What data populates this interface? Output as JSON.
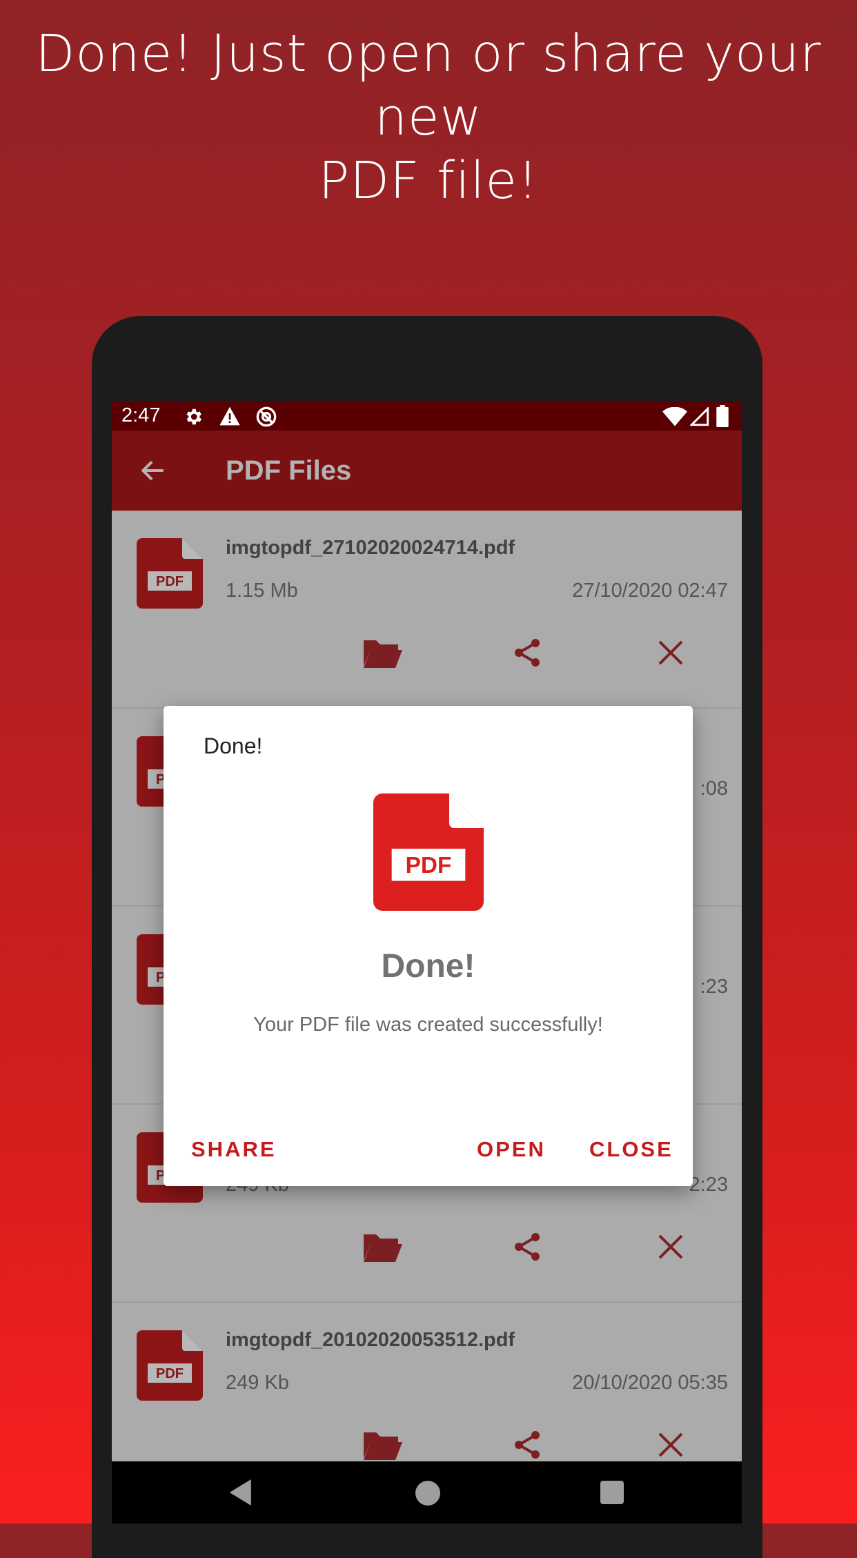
{
  "headline": {
    "line1": "Done! Just open or share your new",
    "line2": "PDF file!"
  },
  "status_bar": {
    "time": "2:47",
    "left_icons": [
      "gear-icon",
      "warning-icon",
      "at-sign-icon"
    ],
    "right_icons": [
      "wifi-icon",
      "signal-icon",
      "battery-icon"
    ]
  },
  "app_bar": {
    "title": "PDF Files",
    "back_icon": "arrow-left-icon"
  },
  "files": [
    {
      "name": "imgtopdf_27102020024714.pdf",
      "size": "1.15 Mb",
      "date": "27/10/2020 02:47"
    },
    {
      "name": "",
      "size": "",
      "date": ":08"
    },
    {
      "name": "",
      "size": "",
      "date": ":23"
    },
    {
      "name": "",
      "size": "249 Kb",
      "date": "2:23"
    },
    {
      "name": "imgtopdf_20102020053512.pdf",
      "size": "249 Kb",
      "date": "20/10/2020 05:35"
    }
  ],
  "file_actions": [
    "folder-open-icon",
    "share-icon",
    "close-icon"
  ],
  "pdf_badge": "PDF",
  "dialog": {
    "title": "Done!",
    "heading": "Done!",
    "message": "Your PDF file was created successfully!",
    "buttons": {
      "share": "SHARE",
      "open": "OPEN",
      "close": "CLOSE"
    }
  },
  "colors": {
    "accent": "#c51b1f",
    "pdf_red": "#dc1f1f",
    "app_bar": "#7c1113",
    "status_bar": "#5a0003"
  }
}
